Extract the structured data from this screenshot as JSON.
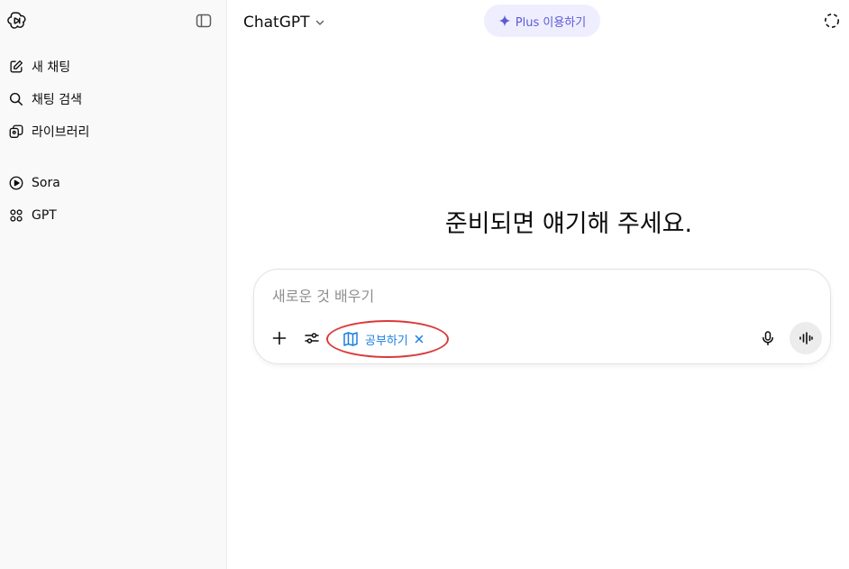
{
  "sidebar": {
    "items": [
      {
        "label": "새 채팅",
        "icon": "new-chat-icon"
      },
      {
        "label": "채팅 검색",
        "icon": "search-icon"
      },
      {
        "label": "라이브러리",
        "icon": "library-icon"
      },
      {
        "label": "Sora",
        "icon": "play-circle-icon"
      },
      {
        "label": "GPT",
        "icon": "grid-icon"
      }
    ]
  },
  "header": {
    "model_name": "ChatGPT",
    "plus_label": "Plus 이용하기"
  },
  "main": {
    "headline": "준비되면 얘기해 주세요."
  },
  "composer": {
    "placeholder": "새로운 것 배우기",
    "chip_label": "공부하기"
  },
  "colors": {
    "accent": "#5b5bd6",
    "chip": "#1b7fe0",
    "highlight": "#d93a3a"
  }
}
